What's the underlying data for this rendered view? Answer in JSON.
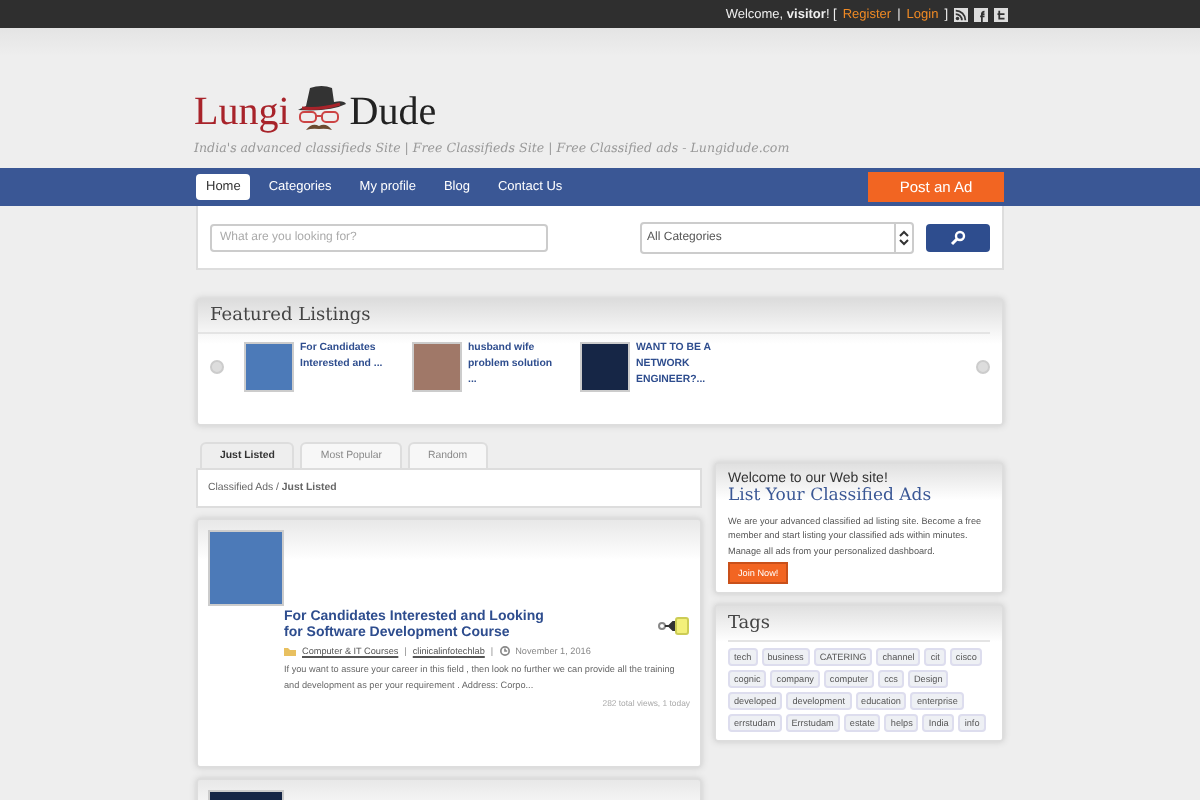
{
  "top_bar": {
    "items": [
      {
        "kind": "text",
        "text": "Welcome, **visitor**! ["
      },
      {
        "kind": "link",
        "text": "Register"
      },
      {
        "kind": "text",
        "text": "|"
      },
      {
        "kind": "link",
        "text": "Login"
      },
      {
        "kind": "text",
        "text": "]"
      }
    ]
  },
  "header": {
    "logo_left": "Lungi",
    "logo_right": "Dude",
    "tagline": "India's advanced classifieds Site | Free Classifieds Site | Free Classified ads - Lungidude.com"
  },
  "nav": {
    "items": [
      {
        "label": "Home",
        "selected": true
      },
      {
        "label": "Categories",
        "selected": false
      },
      {
        "label": "My profile",
        "selected": false
      },
      {
        "label": "Blog",
        "selected": false
      },
      {
        "label": "Contact Us",
        "selected": false
      }
    ],
    "post_button": "Post an Ad"
  },
  "search": {
    "placeholder": "What are you looking for?",
    "category": "All Categories"
  },
  "featured": {
    "title": "Featured Listings",
    "items": [
      {
        "title": "For Candidates Interested and ..."
      },
      {
        "title": "husband wife problem solution ..."
      },
      {
        "title": "WANT TO BE A NETWORK ENGINEER?..."
      }
    ]
  },
  "tabs": [
    {
      "label": "Just Listed",
      "selected": true
    },
    {
      "label": "Most Popular",
      "selected": false
    },
    {
      "label": "Random",
      "selected": false
    }
  ],
  "breadcrumb": "Classified Ads / **Just Listed**",
  "listing": {
    "title": "For Candidates Interested and Looking for Software Development Course",
    "category": "Computer & IT Courses",
    "author": "clinicalinfotechlab",
    "date": "November 1, 2016",
    "excerpt": "If you want to assure your career in this field , then look no further we can provide all the training and development as per your requirement . Address: Corpo...",
    "stats": "282 total views, 1 today",
    "separator": "|"
  },
  "welcome_card": {
    "subtitle": "Welcome to our Web site!",
    "title": "List Your Classified Ads",
    "text": "We are your advanced classified ad listing site. Become a free member and start listing your classified ads within minutes. Manage all ads from your personalized dashboard.",
    "button": "Join Now!"
  },
  "tags": {
    "title": "Tags",
    "items": [
      "tech",
      "business",
      "CATERING",
      "channel",
      "cit",
      "cisco",
      "cognic",
      "company",
      "computer",
      "ccs",
      "Design",
      "developed",
      "development",
      "education",
      "enterprise",
      "errstudam",
      "Errstudam",
      "estate",
      "helps",
      "India",
      "info"
    ]
  }
}
